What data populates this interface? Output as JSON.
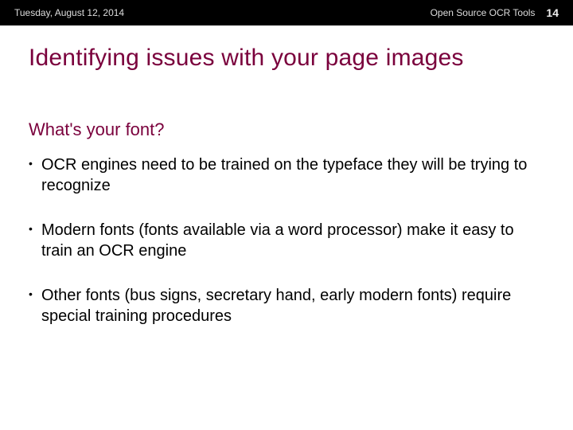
{
  "header": {
    "date": "Tuesday, August 12, 2014",
    "topic": "Open Source OCR Tools",
    "slide_number": "14"
  },
  "slide": {
    "title": "Identifying issues with your page images",
    "subtitle": "What's your font?",
    "bullets": [
      "OCR engines need to be trained on the typeface they will be trying to recognize",
      "Modern fonts (fonts available via a word processor) make it easy to train an OCR engine",
      "Other fonts (bus signs, secretary hand, early modern fonts) require special training procedures"
    ]
  }
}
